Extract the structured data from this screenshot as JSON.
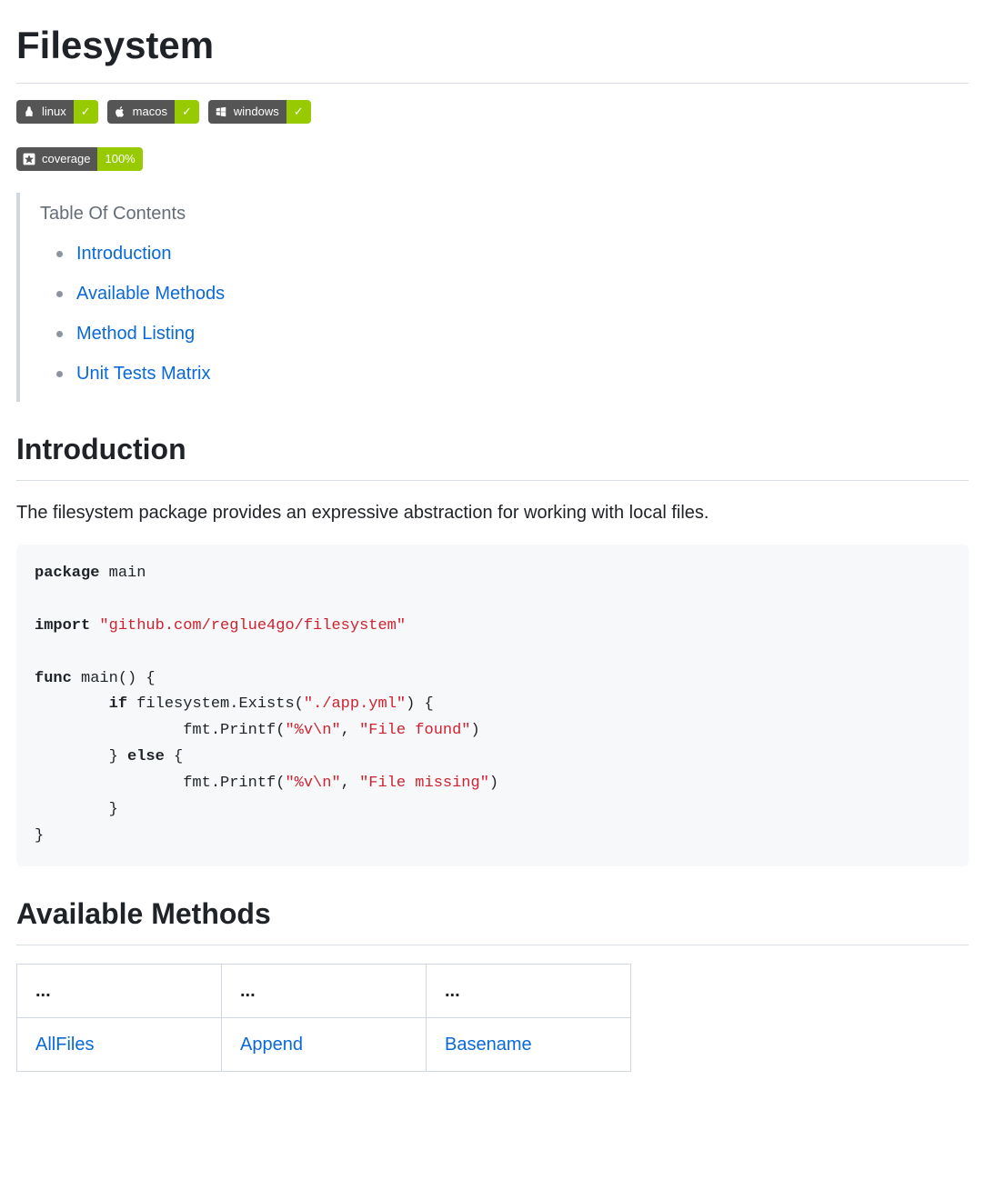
{
  "page_title": "Filesystem",
  "badges": {
    "linux": {
      "label": "linux",
      "value": "✓"
    },
    "macos": {
      "label": "macos",
      "value": "✓"
    },
    "windows": {
      "label": "windows",
      "value": "✓"
    },
    "coverage": {
      "label": "coverage",
      "value": "100%"
    }
  },
  "toc": {
    "title": "Table Of Contents",
    "items": [
      {
        "label": "Introduction"
      },
      {
        "label": "Available Methods"
      },
      {
        "label": "Method Listing"
      },
      {
        "label": "Unit Tests Matrix"
      }
    ]
  },
  "sections": {
    "introduction": {
      "heading": "Introduction",
      "body": "The filesystem package provides an expressive abstraction for working with local files."
    },
    "available_methods": {
      "heading": "Available Methods"
    }
  },
  "code": {
    "t": {
      "package": "package",
      "main1": " main",
      "import": "import",
      "import_path": " \"github.com/reglue4go/filesystem\"",
      "func": "func",
      "main2": " main() {",
      "if": "if",
      "exists_call": " filesystem.Exists(",
      "exists_arg": "\"./app.yml\"",
      "exists_close": ") {",
      "printf1_pre": "                fmt.Printf(",
      "fmt1": "\"%v\\n\"",
      "comma": ", ",
      "found": "\"File found\"",
      "close_paren": ")",
      "else_line_pre": "        } ",
      "else": "else",
      "else_line_post": " {",
      "printf2_pre": "                fmt.Printf(",
      "fmt2": "\"%v\\n\"",
      "missing": "\"File missing\"",
      "inner_close": "        }",
      "outer_close": "}"
    }
  },
  "methods_table": {
    "headers": [
      "...",
      "...",
      "..."
    ],
    "rows": [
      [
        "AllFiles",
        "Append",
        "Basename"
      ]
    ]
  }
}
